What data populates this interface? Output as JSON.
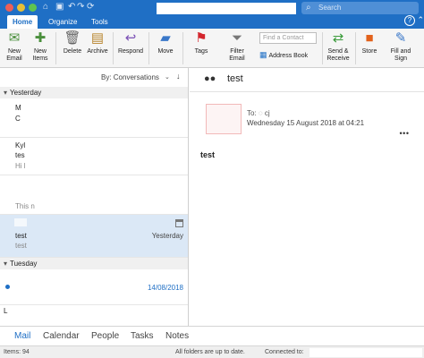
{
  "titlebar": {
    "search_placeholder": "Search"
  },
  "ribbon_tabs": [
    "Home",
    "Organize",
    "Tools"
  ],
  "ribbon": {
    "new_email": "New\nEmail",
    "new_items": "New\nItems",
    "delete": "Delete",
    "archive": "Archive",
    "respond": "Respond",
    "move": "Move",
    "tags": "Tags",
    "filter_email": "Filter\nEmail",
    "find_contact_placeholder": "Find a Contact",
    "address_book": "Address Book",
    "send_receive": "Send &\nReceive",
    "store": "Store",
    "fill_and_sign": "Fill and\nSign"
  },
  "list": {
    "sort_label": "By: Conversations",
    "groups": {
      "yesterday": "Yesterday",
      "tuesday": "Tuesday"
    },
    "messages": [
      {
        "line1": "M",
        "line2": "C",
        "line3": "",
        "date": ""
      },
      {
        "line1": "Kyl",
        "line2": "tes",
        "line3": "Hi l",
        "date": ""
      },
      {
        "line1": "",
        "line2": "This n",
        "line3": "",
        "date": ""
      },
      {
        "line1": "test",
        "line2": "test",
        "line3": "",
        "date": "Yesterday"
      },
      {
        "line1": "",
        "line2": "",
        "line3": "",
        "date": "14/08/2018"
      },
      {
        "line1": "L",
        "line2": "",
        "line3": "",
        "date": ""
      }
    ]
  },
  "reading": {
    "subject": "test",
    "to_label": "To:",
    "recipient": "cj",
    "date": "Wednesday 15 August 2018 at 04:21",
    "body": "test"
  },
  "modules": [
    "Mail",
    "Calendar",
    "People",
    "Tasks",
    "Notes"
  ],
  "status": {
    "items": "Items: 94",
    "sync": "All folders are up to date.",
    "connected": "Connected to:"
  },
  "colors": {
    "brand": "#1f6fc5",
    "selected_row": "#dbe8f6"
  }
}
